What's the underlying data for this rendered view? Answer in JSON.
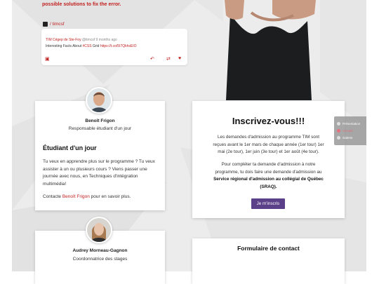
{
  "error_message": "possible solutions to fix the error.",
  "twitter": {
    "handle": "/ timcsf",
    "tweet": {
      "author": "TIM Cégep de Ste-Foy",
      "account": "@timcsf",
      "time": "9 months ago",
      "text_prefix": "Interesting Facts About ",
      "text_highlight": "#CSS",
      "text_middle": " Grid ",
      "link": "https://t.co/5I7QkhsEIO"
    }
  },
  "card_benoit": {
    "name": "Benoît Frigon",
    "role": "Responsable étudiant d'un jour",
    "heading": "Étudiant d'un jour",
    "lines": [
      "Tu veux en apprendre plus sur le programme ? Tu veux",
      "assister à un ou plusieurs cours ? Viens passer une",
      "journée avec nous, en Techniques d'intégration",
      "multimédia!"
    ],
    "contact_prefix": "Contacte ",
    "contact_link": "Benoît Frigon",
    "contact_suffix": " pour en savoir plus."
  },
  "card_inscription": {
    "title": "Inscrivez-vous!!!",
    "para1_lines": [
      "Les demandes d'admission au programme TIM sont",
      "reçues avant le 1er mars de chaque année (1er tour) 1er",
      "mai (2e tour), 1er juin (3e tour) et 1er août (4e tour)."
    ],
    "para2_lines": [
      "Pour compléter ta demande d'admission à notre",
      "programme, tu dois faire une demande d'admission au"
    ],
    "para2_bold1": "Service régional d'admission au collégial de Québec",
    "para2_bold2": "(SRAQ).",
    "button_label": "Je m'inscris"
  },
  "side_nav": {
    "items": [
      "Présentation",
      "Accueil",
      "Galerie"
    ],
    "active_index": 1
  },
  "card_audrey": {
    "name": "Audrey Morneau-Gagnon",
    "role": "Coordonnatrice des stages"
  },
  "card_form": {
    "title": "Formulaire de contact"
  },
  "colors": {
    "accent_red": "#c0201f",
    "button_purple": "#5b3f88",
    "background": "#ececec"
  }
}
